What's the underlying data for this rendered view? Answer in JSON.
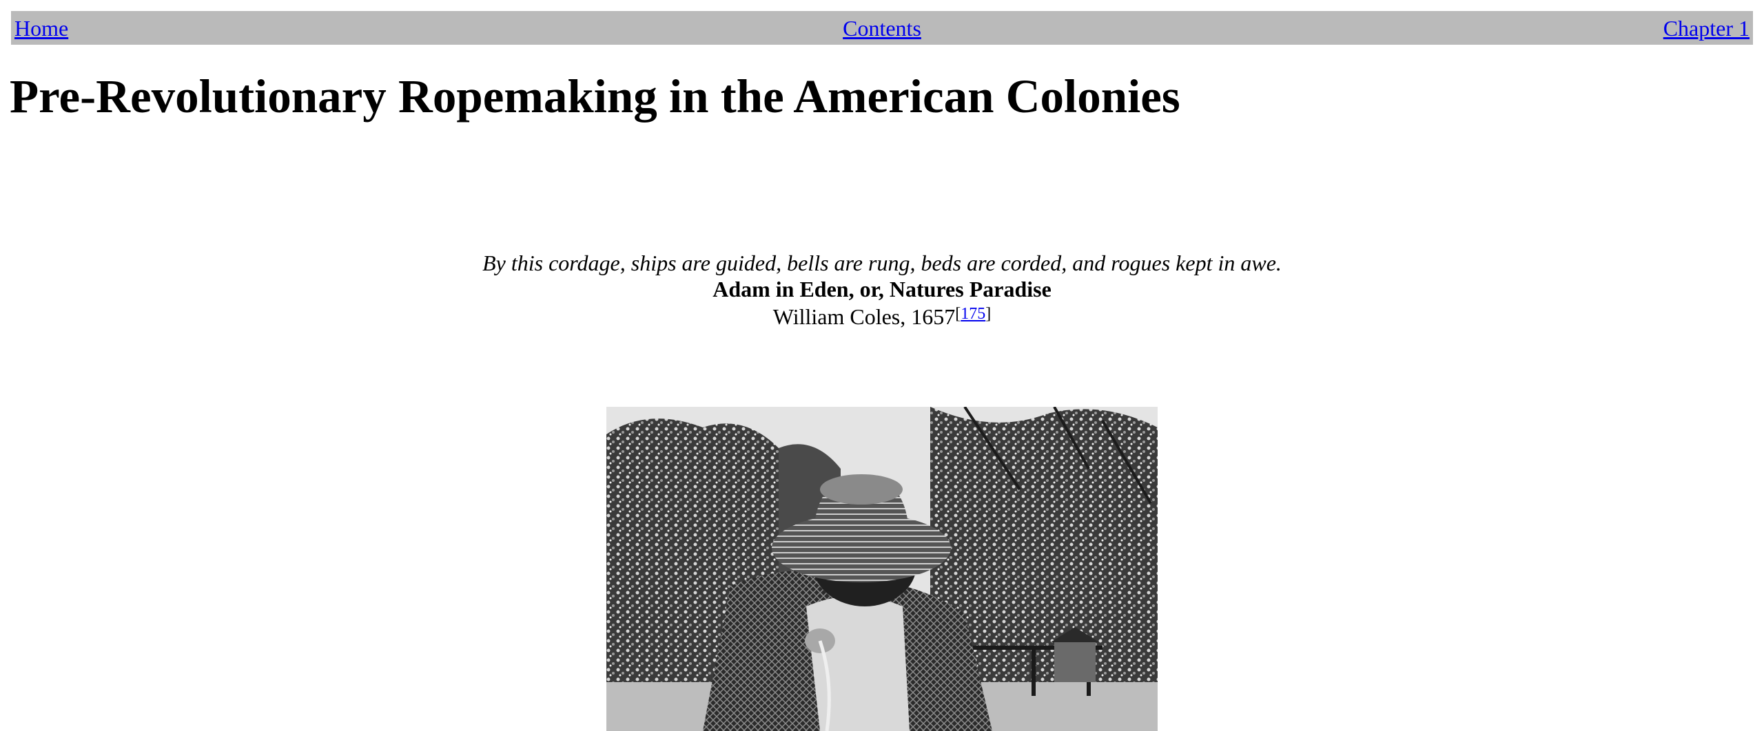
{
  "nav": {
    "home_label": "Home",
    "contents_label": "Contents",
    "next_label": "Chapter 1",
    "bar_color": "#bababa",
    "link_color": "#0000ee"
  },
  "page": {
    "title": "Pre-Revolutionary Ropemaking in the American Colonies"
  },
  "epigraph": {
    "quote": "By this cordage, ships are guided, bells are rung, beds are corded, and rogues kept in awe.",
    "source": "Adam in Eden, or, Natures Paradise",
    "author": "William Coles, 1657",
    "footnote_open": "[",
    "footnote_ref": "175",
    "footnote_close": "]"
  },
  "figure": {
    "description_icon": "photo-ropemaker-in-straw-hat"
  }
}
